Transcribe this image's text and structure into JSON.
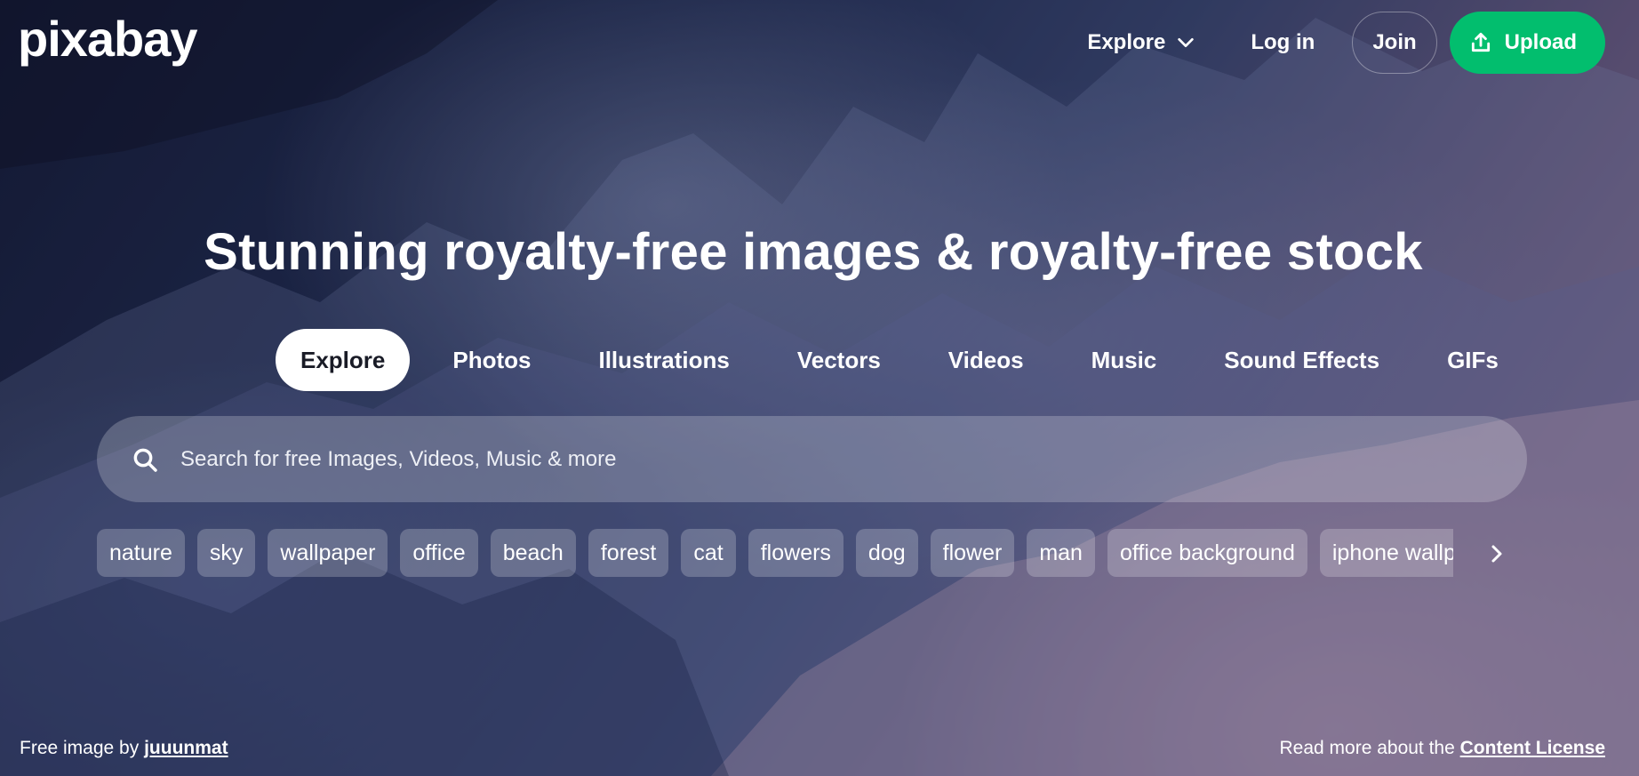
{
  "header": {
    "logo": "pixabay",
    "nav": {
      "explore_label": "Explore",
      "login_label": "Log in",
      "join_label": "Join",
      "upload_label": "Upload"
    }
  },
  "hero": {
    "headline": "Stunning royalty-free images & royalty-free stock"
  },
  "tabs": [
    {
      "label": "Explore",
      "active": true
    },
    {
      "label": "Photos",
      "active": false
    },
    {
      "label": "Illustrations",
      "active": false
    },
    {
      "label": "Vectors",
      "active": false
    },
    {
      "label": "Videos",
      "active": false
    },
    {
      "label": "Music",
      "active": false
    },
    {
      "label": "Sound Effects",
      "active": false
    },
    {
      "label": "GIFs",
      "active": false
    }
  ],
  "search": {
    "placeholder": "Search for free Images, Videos, Music & more",
    "value": ""
  },
  "tags": [
    "nature",
    "sky",
    "wallpaper",
    "office",
    "beach",
    "forest",
    "cat",
    "flowers",
    "dog",
    "flower",
    "man",
    "office background",
    "iphone wallpaper"
  ],
  "footer": {
    "credit_prefix": "Free image by",
    "credit_author": "juuunmat",
    "license_prefix": "Read more about the",
    "license_link": "Content License"
  },
  "colors": {
    "accent": "#02be6e",
    "text": "#ffffff",
    "active_tab_bg": "#ffffff"
  },
  "icons": {
    "explore_chevron": "chevron-down-icon",
    "upload": "upload-icon",
    "search": "search-icon",
    "chips_next": "chevron-right-icon"
  }
}
